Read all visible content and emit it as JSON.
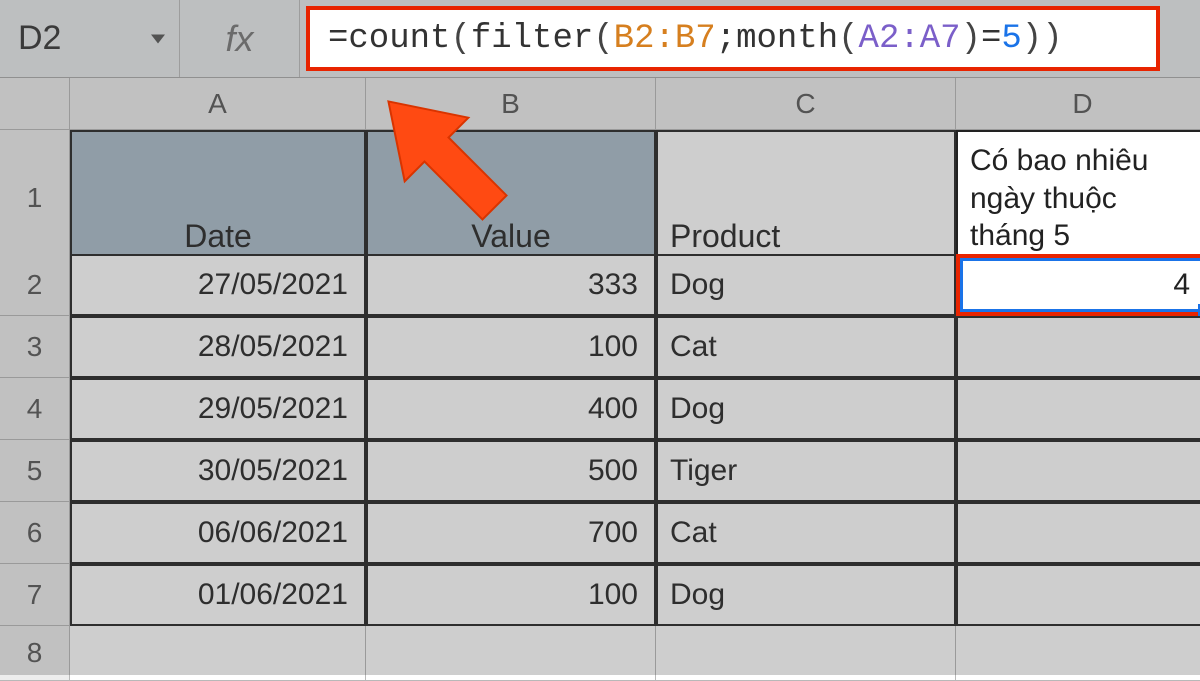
{
  "cell_reference": "D2",
  "fx_label": "fx",
  "formula": {
    "prefix": "=",
    "fn1": "count",
    "paren1": "(",
    "fn2": "filter",
    "paren2": "(",
    "range1": "B2:B7",
    "sep1": ";",
    "fn3": "month",
    "paren3": "(",
    "range2": "A2:A7",
    "paren4": ")",
    "eq": "=",
    "num": "5",
    "paren5": "))"
  },
  "columns": [
    "A",
    "B",
    "C",
    "D"
  ],
  "row_numbers": [
    "1",
    "2",
    "3",
    "4",
    "5",
    "6",
    "7",
    "8"
  ],
  "headers": {
    "a": "Date",
    "b": "Value",
    "c": "Product",
    "d": "Có bao nhiêu ngày thuộc tháng 5"
  },
  "rows": [
    {
      "date": "27/05/2021",
      "value": "333",
      "product": "Dog",
      "d": "4"
    },
    {
      "date": "28/05/2021",
      "value": "100",
      "product": "Cat",
      "d": ""
    },
    {
      "date": "29/05/2021",
      "value": "400",
      "product": "Dog",
      "d": ""
    },
    {
      "date": "30/05/2021",
      "value": "500",
      "product": "Tiger",
      "d": ""
    },
    {
      "date": "06/06/2021",
      "value": "700",
      "product": "Cat",
      "d": ""
    },
    {
      "date": "01/06/2021",
      "value": "100",
      "product": "Dog",
      "d": ""
    }
  ]
}
